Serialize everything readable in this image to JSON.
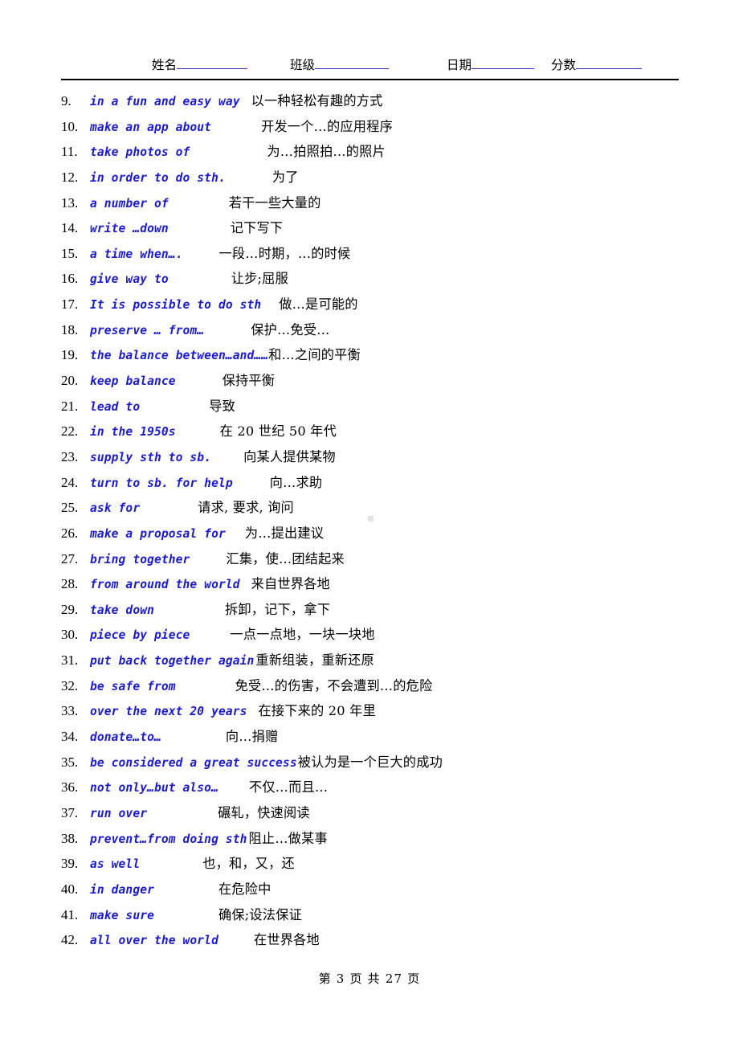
{
  "header": {
    "fields": [
      {
        "label": "姓名",
        "value": ""
      },
      {
        "label": "班级",
        "value": ""
      },
      {
        "label": "日期",
        "value": ""
      },
      {
        "label": "分数",
        "value": ""
      }
    ]
  },
  "list": {
    "rows": [
      {
        "num": "9.",
        "en": "in a fun and easy way",
        "cn": "以一种轻松有趣的方式",
        "gap": 14
      },
      {
        "num": "10.",
        "en": "make an app about",
        "cn": "开发一个…的应用程序",
        "gap": 62
      },
      {
        "num": "11.",
        "en": "take photos of",
        "cn": "为…拍照拍…的照片",
        "gap": 96
      },
      {
        "num": "12.",
        "en": "in order to  do sth.",
        "cn": "为了",
        "gap": 58
      },
      {
        "num": "13.",
        "en": "a number of",
        "cn": "若干一些大量的",
        "gap": 75
      },
      {
        "num": "14.",
        "en": "write …down",
        "cn": "记下写下",
        "gap": 77
      },
      {
        "num": "15.",
        "en": "a time when….",
        "cn": "一段…时期，…的时候",
        "gap": 45
      },
      {
        "num": "16.",
        "en": "give way to",
        "cn": "让步;屈服",
        "gap": 78
      },
      {
        "num": "17.",
        "en": "It is possible to do sth",
        "cn": "做…是可能的",
        "gap": 22
      },
      {
        "num": "18.",
        "en": "preserve … from…",
        "cn": "保护…免受…",
        "gap": 58
      },
      {
        "num": "19.",
        "en": "the balance between…and……",
        "cn": "和…之间的平衡",
        "gap": 0
      },
      {
        "num": "20.",
        "en": "keep balance",
        "cn": "保持平衡",
        "gap": 58
      },
      {
        "num": "21.",
        "en": "lead to",
        "cn": "导致",
        "gap": 86
      },
      {
        "num": "22.",
        "en": "in the 1950s",
        "cn": "在 20 世纪 50 年代",
        "gap": 55
      },
      {
        "num": "23.",
        "en": "supply sth to sb.",
        "cn": "向某人提供某物",
        "gap": 40
      },
      {
        "num": "24.",
        "en": "turn to sb. for help",
        "cn": "向…求助",
        "gap": 46
      },
      {
        "num": "25.",
        "en": "ask for",
        "cn": "请求, 要求, 询问",
        "gap": 72
      },
      {
        "num": "26.",
        "en": "make a proposal for",
        "cn": "为…提出建议",
        "gap": 24
      },
      {
        "num": "27.",
        "en": "bring together",
        "cn": "汇集，使…团结起来",
        "gap": 45
      },
      {
        "num": "28.",
        "en": "from around the world",
        "cn": "来自世界各地",
        "gap": 14
      },
      {
        "num": "29.",
        "en": "take down",
        "cn": "拆卸，记下，拿下",
        "gap": 88
      },
      {
        "num": "30.",
        "en": "piece by piece",
        "cn": "一点一点地，一块一块地",
        "gap": 50
      },
      {
        "num": "31.",
        "en": "put back together again",
        "cn": "重新组装，重新还原",
        "gap": 2
      },
      {
        "num": "32.",
        "en": "be safe from",
        "cn": "免受…的伤害，不会遭到…的危险",
        "gap": 74
      },
      {
        "num": "33.",
        "en": "over the next 20 years",
        "cn": "在接下来的 20 年里",
        "gap": 14
      },
      {
        "num": "34.",
        "en": "donate…to…",
        "cn": "向…捐赠",
        "gap": 80
      },
      {
        "num": "35.",
        "en": "be considered a great success",
        "cn": "被认为是一个巨大的成功",
        "gap": 1
      },
      {
        "num": "36.",
        "en": "not only…but also…",
        "cn": "不仅…而且…",
        "gap": 38
      },
      {
        "num": "37.",
        "en": "run over",
        "cn": "碾轧，快速阅读",
        "gap": 88
      },
      {
        "num": "38.",
        "en": "prevent…from doing sth",
        "cn": "阻止…做某事",
        "gap": 2
      },
      {
        "num": "39.",
        "en": "as well",
        "cn": "也，和，又，还",
        "gap": 78
      },
      {
        "num": "40.",
        "en": "in danger",
        "cn": "在危险中",
        "gap": 80
      },
      {
        "num": "41.",
        "en": "make sure",
        "cn": "确保;设法保证",
        "gap": 80
      },
      {
        "num": "42.",
        "en": "all over the world",
        "cn": "在世界各地",
        "gap": 44
      }
    ]
  },
  "footer": {
    "page_text": "第 3 页 共 27 页",
    "current_page": 3,
    "total_pages": 27
  },
  "colors": {
    "english_blue": "#1a1ad6",
    "rule_blue": "#2b2bd0",
    "text_black": "#000000",
    "page_background": "#ffffff"
  }
}
